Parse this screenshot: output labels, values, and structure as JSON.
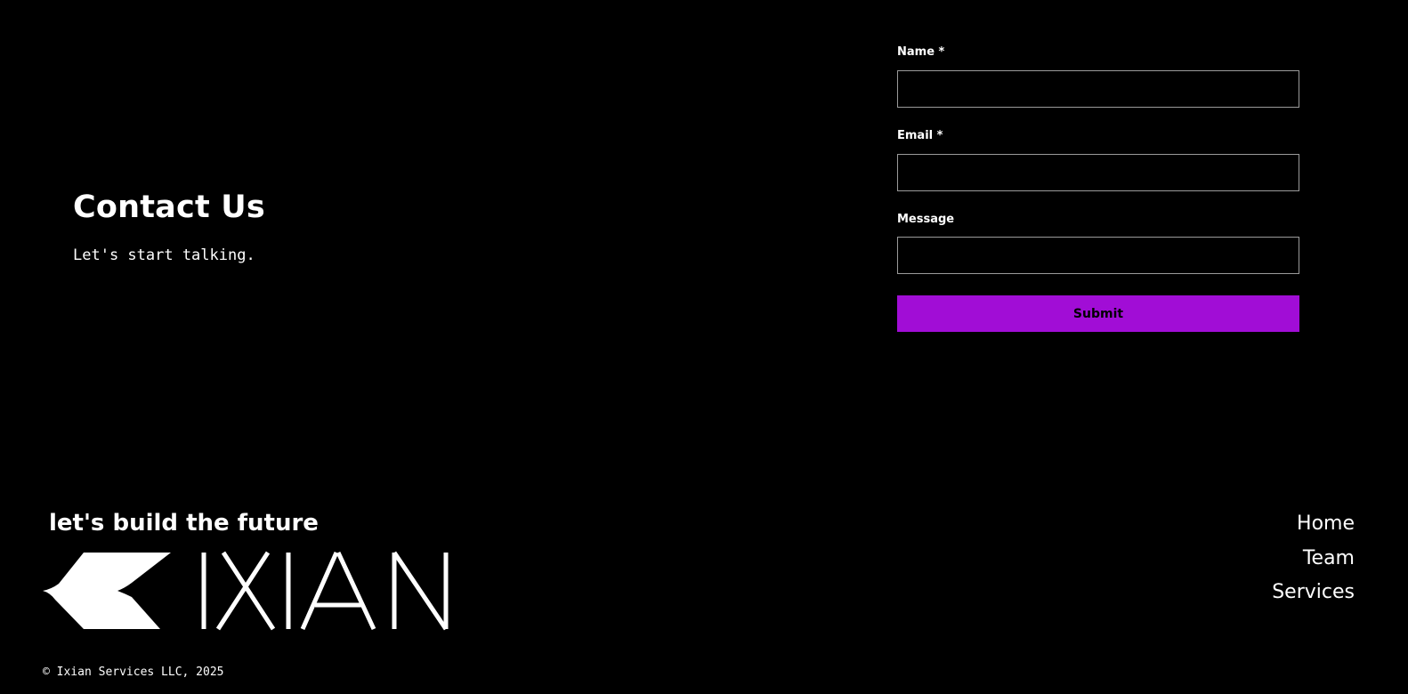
{
  "contact": {
    "title": "Contact Us",
    "subtitle": "Let's start talking."
  },
  "form": {
    "name_label": "Name *",
    "name_value": "",
    "email_label": "Email *",
    "email_value": "",
    "message_label": "Message",
    "message_value": "",
    "submit_label": "Submit"
  },
  "footer": {
    "tagline": "let's build the future",
    "logo_text": "IXIAN",
    "nav": [
      "Home",
      "Team",
      "Services"
    ],
    "copyright": "© Ixian Services LLC, 2025"
  },
  "colors": {
    "background": "#000000",
    "accent": "#a10dd6",
    "text": "#ffffff",
    "input_border": "#9a9a9a"
  },
  "icons": {
    "logo_mark": "ixian-logo-icon"
  }
}
